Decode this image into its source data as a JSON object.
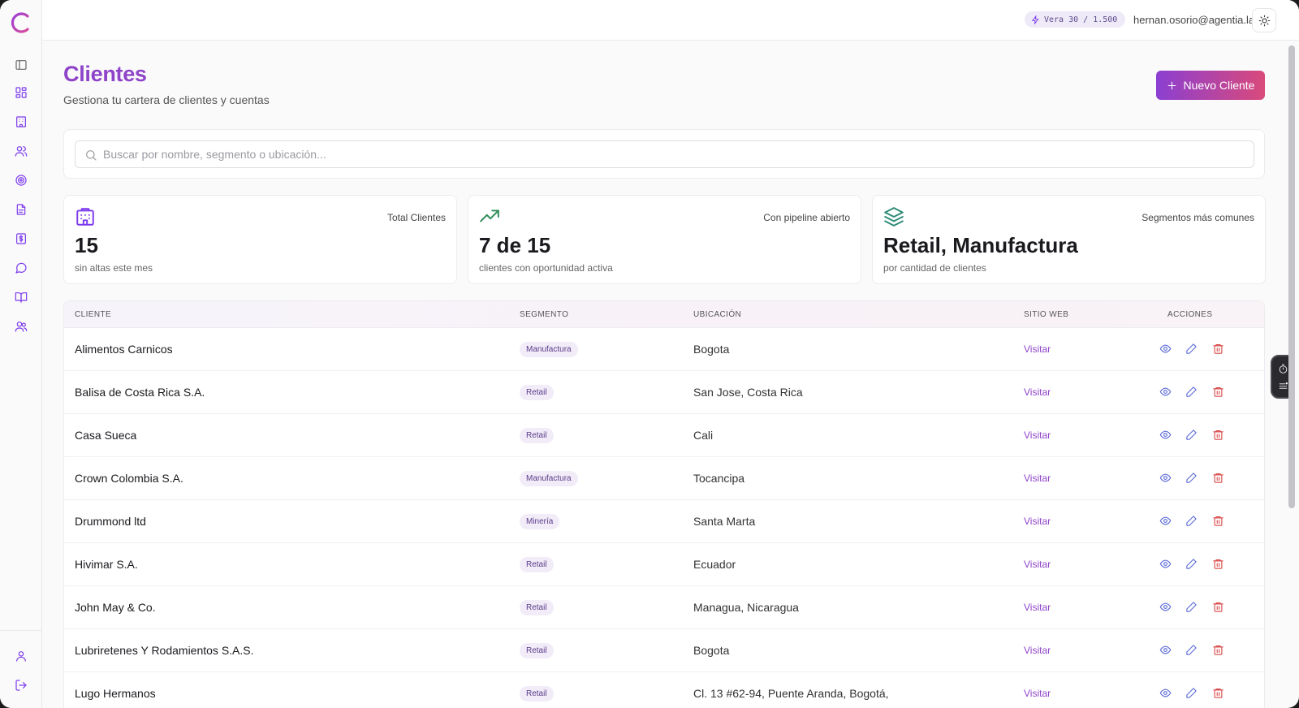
{
  "topbar": {
    "credits": "Vera 30 / 1.500",
    "user_email": "hernan.osorio@agentia.la"
  },
  "sidebar": {
    "items": [
      {
        "name": "sidebar-toggle",
        "icon": "panel-left-icon"
      },
      {
        "name": "dashboard",
        "icon": "dashboard-icon"
      },
      {
        "name": "clientes",
        "icon": "building-icon"
      },
      {
        "name": "contactos",
        "icon": "users-icon"
      },
      {
        "name": "oportunidades",
        "icon": "target-icon"
      },
      {
        "name": "documentos",
        "icon": "file-text-icon"
      },
      {
        "name": "facturacion",
        "icon": "dollar-doc-icon"
      },
      {
        "name": "mensajes",
        "icon": "message-circle-icon"
      },
      {
        "name": "conocimiento",
        "icon": "book-open-icon"
      },
      {
        "name": "equipo",
        "icon": "team-icon"
      }
    ],
    "bottom": [
      {
        "name": "perfil",
        "icon": "user-icon"
      },
      {
        "name": "logout",
        "icon": "log-out-icon"
      }
    ]
  },
  "header": {
    "title": "Clientes",
    "subtitle": "Gestiona tu cartera de clientes y cuentas",
    "new_button": "Nuevo Cliente"
  },
  "search": {
    "placeholder": "Buscar por nombre, segmento o ubicación..."
  },
  "stats": [
    {
      "label": "Total Clientes",
      "value": "15",
      "sub": "sin altas este mes",
      "icon": "building-icon"
    },
    {
      "label": "Con pipeline abierto",
      "value": "7 de 15",
      "sub": "clientes con oportunidad activa",
      "icon": "trending-up-icon"
    },
    {
      "label": "Segmentos más comunes",
      "value": "Retail, Manufactura",
      "sub": "por cantidad de clientes",
      "icon": "layers-icon"
    }
  ],
  "table": {
    "headers": {
      "cliente": "CLIENTE",
      "segmento": "SEGMENTO",
      "ubicacion": "UBICACIÓN",
      "sitio": "SITIO WEB",
      "acciones": "ACCIONES"
    },
    "rows": [
      {
        "name": "Alimentos Carnicos",
        "segment": "Manufactura",
        "location": "Bogota",
        "link": "Visitar"
      },
      {
        "name": "Balisa de Costa Rica S.A.",
        "segment": "Retail",
        "location": "San Jose, Costa Rica",
        "link": "Visitar"
      },
      {
        "name": "Casa Sueca",
        "segment": "Retail",
        "location": "Cali",
        "link": "Visitar"
      },
      {
        "name": "Crown Colombia S.A.",
        "segment": "Manufactura",
        "location": "Tocancipa",
        "link": "Visitar"
      },
      {
        "name": "Drummond ltd",
        "segment": "Minería",
        "location": "Santa Marta",
        "link": "Visitar"
      },
      {
        "name": "Hivimar S.A.",
        "segment": "Retail",
        "location": "Ecuador",
        "link": "Visitar"
      },
      {
        "name": "John May & Co.",
        "segment": "Retail",
        "location": "Managua, Nicaragua",
        "link": "Visitar"
      },
      {
        "name": "Lubriretenes Y Rodamientos S.A.S.",
        "segment": "Retail",
        "location": "Bogota",
        "link": "Visitar"
      },
      {
        "name": "Lugo Hermanos",
        "segment": "Retail",
        "location": "Cl. 13 #62-94, Puente Aranda, Bogotá,",
        "link": "Visitar"
      }
    ]
  },
  "colors": {
    "brand": "#8e44c9",
    "gradient_start": "#8b3fd1",
    "gradient_end": "#d94a7b",
    "action_blue": "#5b6bd8",
    "action_red": "#d94a4a"
  }
}
